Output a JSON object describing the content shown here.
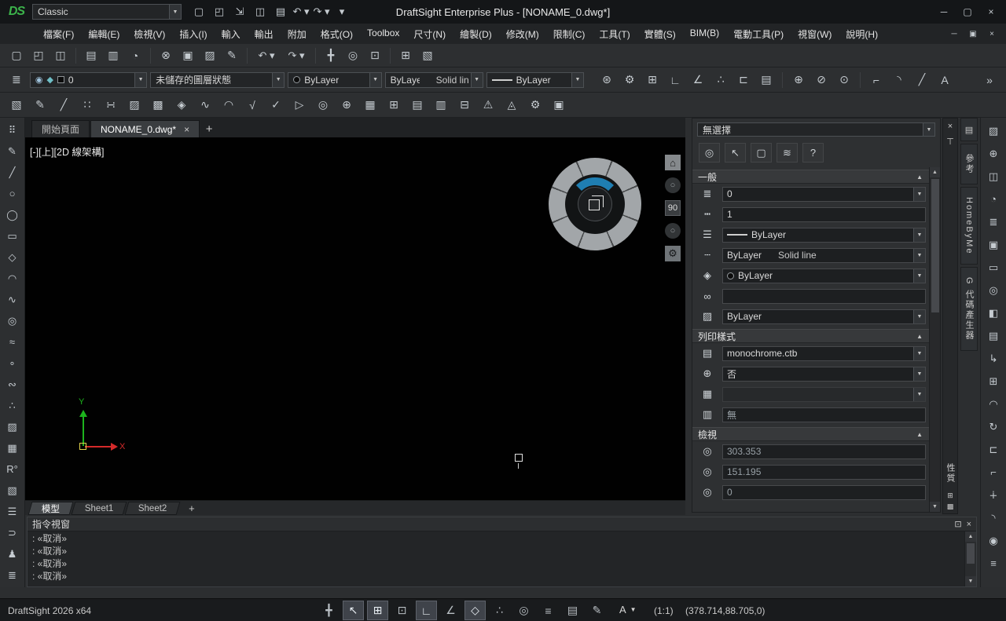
{
  "ui": {
    "combo_arrow": "▼",
    "section_collapse": "▲",
    "sc_up": "▲",
    "sc_down": "▼"
  },
  "titlebar": {
    "logo": "DS",
    "workspace": "Classic",
    "title": "DraftSight Enterprise Plus - [NONAME_0.dwg*]",
    "quick_access": [
      {
        "name": "new-button",
        "glyph": "▢"
      },
      {
        "name": "open-button",
        "glyph": "◰"
      },
      {
        "name": "import-button",
        "glyph": "⇲"
      },
      {
        "name": "save-button",
        "glyph": "◫"
      },
      {
        "name": "print-button",
        "glyph": "▤"
      },
      {
        "name": "undo-button",
        "glyph": "↶ ▾"
      },
      {
        "name": "redo-button",
        "glyph": "↷ ▾"
      },
      {
        "name": "customize-quick-access-button",
        "glyph": "▾"
      }
    ],
    "window_controls": [
      {
        "name": "minimize-button",
        "glyph": "─"
      },
      {
        "name": "maximize-button",
        "glyph": "▢"
      },
      {
        "name": "close-button",
        "glyph": "×"
      }
    ]
  },
  "menubar": {
    "items": [
      {
        "name": "menu-file",
        "label": "檔案(F)"
      },
      {
        "name": "menu-edit",
        "label": "編輯(E)"
      },
      {
        "name": "menu-view",
        "label": "檢視(V)"
      },
      {
        "name": "menu-insert",
        "label": "插入(I)"
      },
      {
        "name": "menu-import",
        "label": "輸入"
      },
      {
        "name": "menu-export",
        "label": "輸出"
      },
      {
        "name": "menu-addins",
        "label": "附加"
      },
      {
        "name": "menu-format",
        "label": "格式(O)"
      },
      {
        "name": "menu-toolbox",
        "label": "Toolbox"
      },
      {
        "name": "menu-dimension",
        "label": "尺寸(N)"
      },
      {
        "name": "menu-draw",
        "label": "繪製(D)"
      },
      {
        "name": "menu-modify",
        "label": "修改(M)"
      },
      {
        "name": "menu-constraints",
        "label": "限制(C)"
      },
      {
        "name": "menu-tools",
        "label": "工具(T)"
      },
      {
        "name": "menu-solids",
        "label": "實體(S)"
      },
      {
        "name": "menu-bim",
        "label": "BIM(B)"
      },
      {
        "name": "menu-power-tools",
        "label": "電動工具(P)"
      },
      {
        "name": "menu-window",
        "label": "視窗(W)"
      },
      {
        "name": "menu-help",
        "label": "說明(H)"
      }
    ],
    "mdi_controls": [
      {
        "name": "mdi-minimize-button",
        "glyph": "─"
      },
      {
        "name": "mdi-restore-button",
        "glyph": "▣"
      },
      {
        "name": "mdi-close-button",
        "glyph": "×"
      }
    ]
  },
  "toolbar_standard": {
    "items": [
      {
        "name": "new-button",
        "glyph": "▢"
      },
      {
        "name": "open-button",
        "glyph": "◰"
      },
      {
        "name": "save-button",
        "glyph": "◫"
      },
      {
        "name": "separator",
        "cls": "sep",
        "interactable": false
      },
      {
        "name": "print-button",
        "glyph": "▤"
      },
      {
        "name": "batch-print-button",
        "glyph": "▥"
      },
      {
        "name": "print-preview-button",
        "glyph": "◔"
      },
      {
        "name": "separator",
        "cls": "sep",
        "interactable": false
      },
      {
        "name": "cut-button",
        "glyph": "⊗"
      },
      {
        "name": "copy-button",
        "glyph": "▣"
      },
      {
        "name": "paste-button",
        "glyph": "▨"
      },
      {
        "name": "properties-painter-button",
        "glyph": "✎"
      },
      {
        "name": "separator",
        "cls": "sep",
        "interactable": false
      },
      {
        "name": "undo-button",
        "glyph": "↶ ▾",
        "cls": "wide"
      },
      {
        "name": "redo-button",
        "glyph": "↷ ▾",
        "cls": "wide"
      },
      {
        "name": "separator",
        "cls": "sep",
        "interactable": false
      },
      {
        "name": "pan-button",
        "glyph": "╋"
      },
      {
        "name": "zoom-dynamic-button",
        "glyph": "◎"
      },
      {
        "name": "zoom-window-button",
        "glyph": "⊡"
      },
      {
        "name": "separator",
        "cls": "sep",
        "interactable": false
      },
      {
        "name": "options-button",
        "glyph": "⊞"
      },
      {
        "name": "design-library-button",
        "glyph": "▧"
      }
    ]
  },
  "toolbar_layer": {
    "manager_glyph": "≣",
    "eye_glyph": "◉",
    "freeze_glyph": "◆",
    "layer_value": "0",
    "layer_state": "未儲存的圖層狀態",
    "color_value": "ByLayer",
    "linestyle_value": "ByLayer",
    "linestyle_desc": "Solid line",
    "lineweight_value": "ByLayer",
    "right_items": [
      {
        "name": "entity-snap-button",
        "glyph": "⊛"
      },
      {
        "name": "settings-button",
        "glyph": "⚙"
      },
      {
        "name": "grid-settings-button",
        "glyph": "⊞"
      },
      {
        "name": "ortho-button",
        "glyph": "∟"
      },
      {
        "name": "polar-button",
        "glyph": "∠"
      },
      {
        "name": "track-button",
        "glyph": "∴"
      },
      {
        "name": "reference-edit-button",
        "glyph": "⊏"
      },
      {
        "name": "annotation-scale-button",
        "glyph": "▤"
      },
      {
        "name": "separator",
        "cls": "sep",
        "interactable": false
      },
      {
        "name": "circle-center-button",
        "glyph": "⊕"
      },
      {
        "name": "circle-tangent-button",
        "glyph": "⊘"
      },
      {
        "name": "circle-point-button",
        "glyph": "⊙"
      },
      {
        "name": "separator",
        "cls": "sep",
        "interactable": false
      },
      {
        "name": "chamfer-button",
        "glyph": "⌐"
      },
      {
        "name": "fillet-button",
        "glyph": "◝"
      },
      {
        "name": "line-button",
        "glyph": "╱"
      },
      {
        "name": "text-style-button",
        "glyph": "A"
      },
      {
        "name": "toolbar-overflow-button",
        "glyph": "»",
        "cls": "push"
      }
    ]
  },
  "toolbar_draw": {
    "items": [
      {
        "name": "reference-image-button",
        "glyph": "▧"
      },
      {
        "name": "pencil-button",
        "glyph": "✎"
      },
      {
        "name": "construction-line-button",
        "glyph": "╱"
      },
      {
        "name": "point-divide-button",
        "glyph": "∷"
      },
      {
        "name": "point-mark-button",
        "glyph": "∺"
      },
      {
        "name": "hatch-button",
        "glyph": "▨"
      },
      {
        "name": "gradient-button",
        "glyph": "▩"
      },
      {
        "name": "boundary-button",
        "glyph": "◈"
      },
      {
        "name": "spline-button",
        "glyph": "∿"
      },
      {
        "name": "arc-3point-button",
        "glyph": "◠"
      },
      {
        "name": "sqrt-button",
        "glyph": "√"
      },
      {
        "name": "validate-button",
        "glyph": "✓"
      },
      {
        "name": "play-button",
        "glyph": "▷"
      },
      {
        "name": "zoom-select-button",
        "glyph": "◎"
      },
      {
        "name": "locate-button",
        "glyph": "⊕"
      },
      {
        "name": "table-button",
        "glyph": "▦"
      },
      {
        "name": "table-cell-button",
        "glyph": "⊞"
      },
      {
        "name": "schedule-button",
        "glyph": "▤"
      },
      {
        "name": "chart-button",
        "glyph": "▥"
      },
      {
        "name": "export-table-button",
        "glyph": "⊟"
      },
      {
        "name": "warning-button",
        "glyph": "⚠"
      },
      {
        "name": "standards-button",
        "glyph": "◬"
      },
      {
        "name": "task-gear-button",
        "glyph": "⚙"
      },
      {
        "name": "palette-button",
        "glyph": "▣"
      }
    ]
  },
  "left_toolbar": {
    "items": [
      {
        "name": "grid-dots-button",
        "glyph": "⠿"
      },
      {
        "name": "pencil-button",
        "glyph": "✎"
      },
      {
        "name": "line-button",
        "glyph": "╱"
      },
      {
        "name": "circle-button",
        "glyph": "○"
      },
      {
        "name": "ellipse-button",
        "glyph": "◯"
      },
      {
        "name": "rectangle-button",
        "glyph": "▭"
      },
      {
        "name": "polygon-button",
        "glyph": "◇"
      },
      {
        "name": "arc-button",
        "glyph": "◠"
      },
      {
        "name": "s-curve-button",
        "glyph": "∿"
      },
      {
        "name": "circle-tangent-button",
        "glyph": "◎"
      },
      {
        "name": "spline-button",
        "glyph": "≈"
      },
      {
        "name": "point-button",
        "glyph": "∘"
      },
      {
        "name": "n-curve-button",
        "glyph": "∾"
      },
      {
        "name": "scatter-button",
        "glyph": "∴"
      },
      {
        "name": "hatch-button",
        "glyph": "▨"
      },
      {
        "name": "grid-button",
        "glyph": "▦"
      },
      {
        "name": "angle-reference-button",
        "glyph": "R°"
      },
      {
        "name": "image-button",
        "glyph": "▧"
      },
      {
        "name": "list-button",
        "glyph": "☰"
      },
      {
        "name": "clip-button",
        "glyph": "⊃"
      },
      {
        "name": "user-button",
        "glyph": "♟"
      },
      {
        "name": "options-button",
        "glyph": "≣"
      }
    ]
  },
  "right_toolbar": {
    "items": [
      {
        "name": "hatch-tool-button",
        "glyph": "▨"
      },
      {
        "name": "circle-plus-button",
        "glyph": "⊕"
      },
      {
        "name": "cabinet-button",
        "glyph": "◫"
      },
      {
        "name": "quarter-circle-button",
        "glyph": "◔"
      },
      {
        "name": "layers-button",
        "glyph": "≣"
      },
      {
        "name": "frame-button",
        "glyph": "▣"
      },
      {
        "name": "ruler-button",
        "glyph": "▭"
      },
      {
        "name": "compass-button",
        "glyph": "◎"
      },
      {
        "name": "half-square-button",
        "glyph": "◧"
      },
      {
        "name": "sheet-button",
        "glyph": "▤"
      },
      {
        "name": "branch-arrow-button",
        "glyph": "↳"
      },
      {
        "name": "snap-grid-button",
        "glyph": "⊞"
      },
      {
        "name": "arc-tool-button",
        "glyph": "◠"
      },
      {
        "name": "revolve-button",
        "glyph": "↻"
      },
      {
        "name": "offset-button",
        "glyph": "⊏"
      },
      {
        "name": "corner-button",
        "glyph": "⌐"
      },
      {
        "name": "plus-tool-button",
        "glyph": "∔"
      },
      {
        "name": "round-corner-button",
        "glyph": "◝"
      },
      {
        "name": "target-button",
        "glyph": "◉"
      },
      {
        "name": "stack-button",
        "glyph": "≡"
      }
    ]
  },
  "doc_tabs": {
    "start": "開始頁面",
    "current": "NONAME_0.dwg*",
    "close": "×",
    "plus": "+"
  },
  "canvas": {
    "viewport_label": "[-][上][2D 線架構]",
    "wheel": {
      "home": "⌂",
      "orbit": "○",
      "angle": "90",
      "settings": "⚙"
    },
    "ucs": {
      "x_label": "X",
      "y_label": "Y"
    }
  },
  "sheet_tabs": {
    "model": "模型",
    "sheet1": "Sheet1",
    "sheet2": "Sheet2",
    "plus": "+"
  },
  "command": {
    "title": "指令視窗",
    "float_glyph": "⊡",
    "close_glyph": "×",
    "lines": [
      ": «取消»",
      ": «取消»",
      ": «取消»",
      ": «取消»"
    ]
  },
  "properties": {
    "selection": "無選擇",
    "vertical_title": "性質",
    "toolbar": [
      {
        "name": "smart-select-button",
        "glyph": "◎"
      },
      {
        "name": "select-entities-button",
        "glyph": "↖"
      },
      {
        "name": "select-window-button",
        "glyph": "▢"
      },
      {
        "name": "quick-filter-button",
        "glyph": "≋"
      },
      {
        "name": "help-button",
        "glyph": "?"
      }
    ],
    "icons": {
      "layer": "≣",
      "linetype_scale": "┅",
      "lineweight": "☰",
      "linestyle": "┄",
      "color": "◈",
      "hyperlink": "∞",
      "transparency": "▨",
      "print_table": "▤",
      "print_display": "⊕",
      "print_area": "▦",
      "print_origin": "▥",
      "view_x": "◎",
      "view_y": "◎",
      "view_z": "◎"
    },
    "general": {
      "title": "一般",
      "layer": "0",
      "linetype_scale": "1",
      "lineweight": "ByLayer",
      "linestyle": "ByLayer",
      "linestyle_desc": "Solid line",
      "color": "ByLayer",
      "hyperlink": "",
      "transparency": "ByLayer"
    },
    "print_style": {
      "title": "列印樣式",
      "table": "monochrome.ctb",
      "display": "否",
      "area": "",
      "origin": "無"
    },
    "view": {
      "title": "檢視",
      "center_x": "303.353",
      "center_y": "151.195",
      "center_z": "0"
    }
  },
  "palette_bar": {
    "close": "×",
    "pin": "⊤",
    "bottom_icons": [
      {
        "name": "dock-grid-button",
        "glyph": "⊞"
      },
      {
        "name": "dock-fill-button",
        "glyph": "▩"
      }
    ]
  },
  "side_tabs": {
    "icon_tab_glyph": "▤",
    "items": [
      {
        "name": "tab-references",
        "label": "參考"
      },
      {
        "name": "tab-homebyme",
        "label": "HomeByMe"
      },
      {
        "name": "tab-gcode-generator",
        "label": "G 代碼產生器"
      }
    ]
  },
  "statusbar": {
    "app": "DraftSight 2026 x64",
    "items": [
      {
        "name": "snap-marker-button",
        "glyph": "╋"
      },
      {
        "name": "cursor-select-button",
        "glyph": "↖",
        "active": true
      },
      {
        "name": "grid-button",
        "glyph": "⊞",
        "active": true
      },
      {
        "name": "snap-button",
        "glyph": "⊡"
      },
      {
        "name": "ortho-button",
        "glyph": "∟",
        "active": true
      },
      {
        "name": "polar-button",
        "glyph": "∠"
      },
      {
        "name": "esnap-button",
        "glyph": "◇",
        "active": true
      },
      {
        "name": "etrack-button",
        "glyph": "∴"
      },
      {
        "name": "entity-bias-button",
        "glyph": "◎"
      },
      {
        "name": "lineweight-button",
        "glyph": "≡"
      },
      {
        "name": "print-area-button",
        "glyph": "▤"
      },
      {
        "name": "annotation-monitor-button",
        "glyph": "✎"
      }
    ],
    "annotation_label": "A",
    "annotation_arrow": "▼",
    "scale": "(1:1)",
    "coords": "(378.714,88.705,0)"
  }
}
